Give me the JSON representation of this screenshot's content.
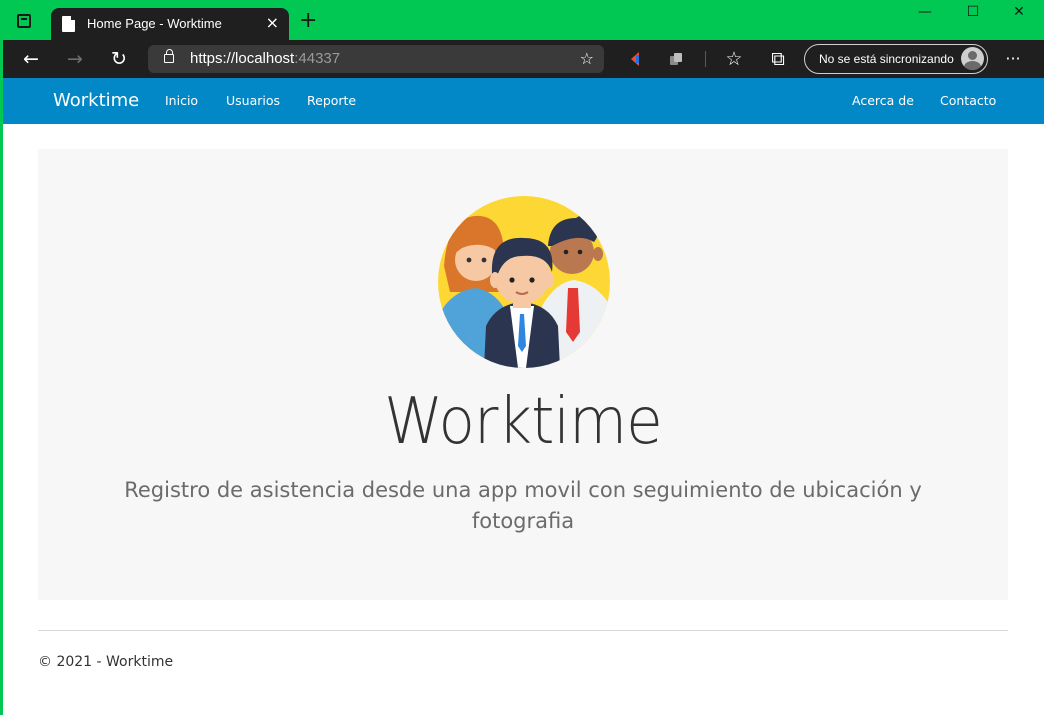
{
  "browser": {
    "tab": {
      "title": "Home Page - Worktime",
      "close_glyph": "×",
      "favicon": "page-icon"
    },
    "new_tab_glyph": "+",
    "window_controls": {
      "minimize": "—",
      "maximize": "☐",
      "close": "✕"
    },
    "address": {
      "host": "https://localhost",
      "port": ":44337"
    },
    "nav": {
      "back": "←",
      "forward": "→",
      "reload": "↻",
      "favorite_add": "☆",
      "favorites": "☆",
      "collections": "⧉",
      "more": "···"
    },
    "sync": {
      "label": "No se está sincronizando"
    },
    "colors": {
      "chrome": "#00c853",
      "toolbar": "#1f1f1f",
      "urlbar": "#3a3a3a"
    }
  },
  "site": {
    "brand": "Worktime",
    "nav_left": [
      "Inicio",
      "Usuarios",
      "Reporte"
    ],
    "nav_right": [
      "Acerca de",
      "Contacto"
    ],
    "colors": {
      "navbar": "#0288c7",
      "jumbotron": "#f7f7f7",
      "illustration_bg": "#fdd835"
    }
  },
  "hero": {
    "title": "Worktime",
    "subtitle": "Registro de asistencia desde una app movil con seguimiento de ubicación y fotografia",
    "illustration": "team-people-icon"
  },
  "footer": {
    "text": "© 2021 - Worktime"
  }
}
